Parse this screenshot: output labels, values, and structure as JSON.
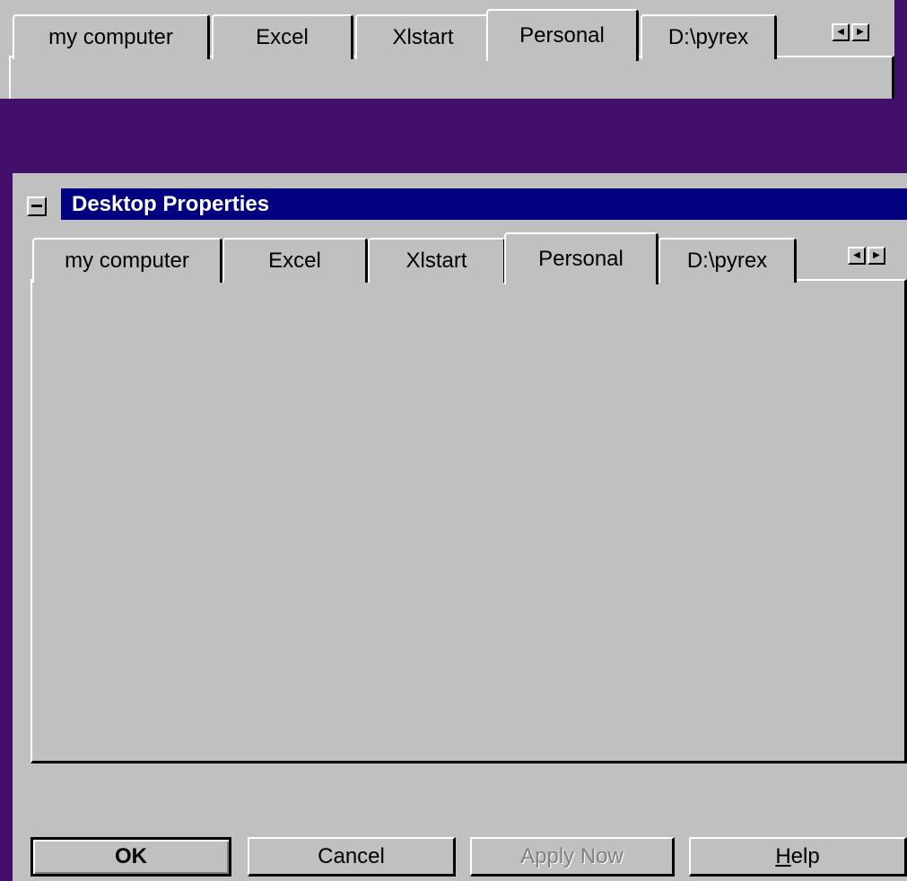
{
  "top": {
    "tabs": [
      {
        "label": "my computer"
      },
      {
        "label": "Excel"
      },
      {
        "label": "Xlstart"
      },
      {
        "label": "Personal"
      },
      {
        "label": "D:\\pyrex"
      }
    ],
    "active_tab": "Personal"
  },
  "dialog": {
    "title": "Desktop Properties",
    "tabs": [
      {
        "label": "my computer"
      },
      {
        "label": "Excel"
      },
      {
        "label": "Xlstart"
      },
      {
        "label": "Personal"
      },
      {
        "label": "D:\\pyrex"
      }
    ],
    "active_tab": "Personal",
    "buttons": {
      "ok": "OK",
      "cancel": "Cancel",
      "apply_now": "Apply Now",
      "help_mnemonic": "H",
      "help_rest": "elp"
    }
  },
  "colors": {
    "desktop": "#42106a",
    "face": "#c0c0c0",
    "titlebar": "#000080"
  },
  "icons": {
    "scroll_left": "left-arrow-icon",
    "scroll_right": "right-arrow-icon",
    "system_menu": "system-menu-icon"
  }
}
